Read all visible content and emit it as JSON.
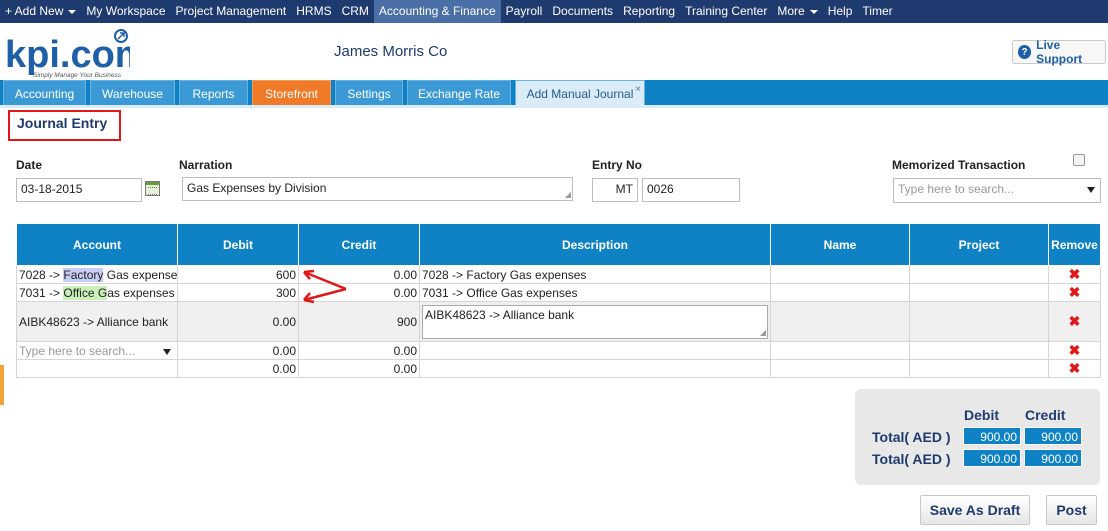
{
  "topnav": {
    "items": [
      "+ Add New",
      "My Workspace",
      "Project Management",
      "HRMS",
      "CRM",
      "Accounting & Finance",
      "Payroll",
      "Documents",
      "Reporting",
      "Training Center",
      "More",
      "Help",
      "Timer"
    ],
    "active_index": 5
  },
  "header": {
    "logo_text": "kpi.com",
    "logo_tagline": "Simply Manage Your Business",
    "company": "James Morris Co",
    "live_support": "Live Support"
  },
  "tabs": [
    "Accounting",
    "Warehouse",
    "Reports",
    "Storefront",
    "Settings",
    "Exchange Rate",
    "Add Manual Journal"
  ],
  "tab_close": "×",
  "page_title": "Journal Entry",
  "form": {
    "date_label": "Date",
    "date_value": "03-18-2015",
    "narration_label": "Narration",
    "narration_value": "Gas Expenses by Division",
    "entry_no_label": "Entry No",
    "entry_prefix": "MT",
    "entry_number": "0026",
    "memorized_label": "Memorized Transaction",
    "memorized_placeholder": "Type here to search..."
  },
  "grid": {
    "headers": [
      "Account",
      "Debit",
      "Credit",
      "Description",
      "Name",
      "Project",
      "Remove"
    ],
    "rows": [
      {
        "account_code": "7028 ->",
        "account_hl": "Factory",
        "account_rest": " Gas expenses",
        "debit": "600",
        "credit": "0.00",
        "description": "7028 -> Factory Gas expenses"
      },
      {
        "account_code": "7031 ->",
        "account_hl": "Office G",
        "account_rest": "as expenses",
        "debit": "300",
        "credit": "0.00",
        "description": "7031 -> Office Gas expenses"
      },
      {
        "account": "AIBK48623 -> Alliance bank",
        "debit": "0.00",
        "credit": "900",
        "description": "AIBK48623 -> Alliance bank"
      },
      {
        "account_placeholder": "Type here to search...",
        "debit": "0.00",
        "credit": "0.00"
      },
      {
        "debit": "0.00",
        "credit": "0.00"
      }
    ],
    "remove_glyph": "✖"
  },
  "totals": {
    "debit_header": "Debit",
    "credit_header": "Credit",
    "rows": [
      {
        "label": "Total( AED )",
        "debit": "900.00",
        "credit": "900.00"
      },
      {
        "label": "Total( AED )",
        "debit": "900.00",
        "credit": "900.00"
      }
    ]
  },
  "buttons": {
    "save_draft": "Save As Draft",
    "post": "Post"
  },
  "colors": {
    "nav": "#1f3a6e",
    "tab_blue": "#0f82c6",
    "tab_orange": "#f07a28",
    "annotation_red": "#e01818"
  }
}
